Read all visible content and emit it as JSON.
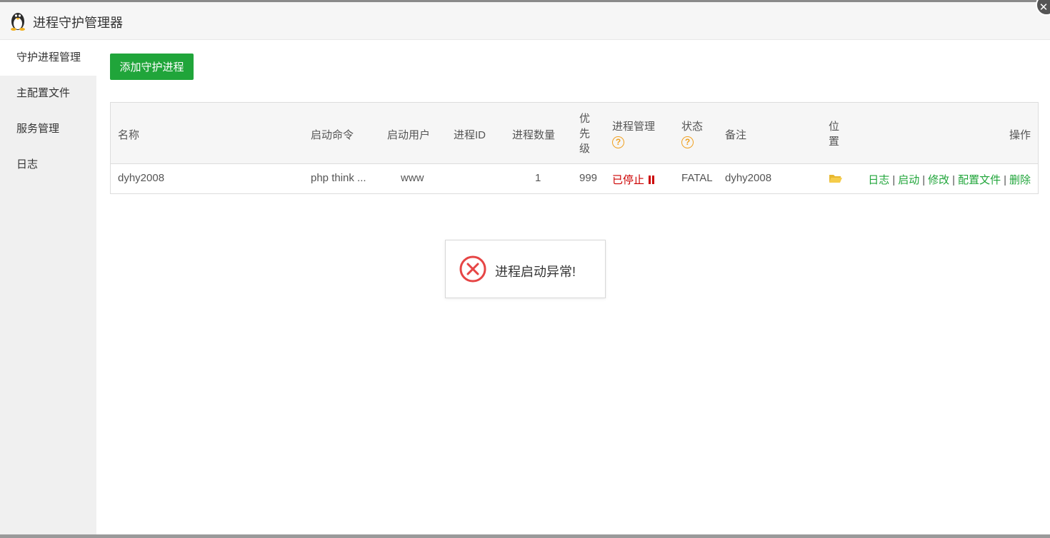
{
  "window": {
    "title": "进程守护管理器"
  },
  "sidebar": {
    "items": [
      {
        "label": "守护进程管理",
        "active": true
      },
      {
        "label": "主配置文件"
      },
      {
        "label": "服务管理"
      },
      {
        "label": "日志"
      }
    ]
  },
  "toolbar": {
    "add_label": "添加守护进程"
  },
  "table": {
    "headers": {
      "name": "名称",
      "command": "启动命令",
      "user": "启动用户",
      "pid": "进程ID",
      "count": "进程数量",
      "priority": [
        "优",
        "先",
        "级"
      ],
      "proc_manage": "进程管理",
      "status": "状态",
      "remark": "备注",
      "location": [
        "位",
        "置"
      ],
      "actions": "操作",
      "help": "?"
    },
    "rows": [
      {
        "name": "dyhy2008",
        "command": "php think ...",
        "user": "www",
        "pid": "",
        "count": "1",
        "priority": "999",
        "proc_state": "已停止",
        "status": "FATAL",
        "remark": "dyhy2008",
        "actions": [
          "日志",
          "启动",
          "修改",
          "配置文件",
          "删除"
        ],
        "action_sep": "|"
      }
    ]
  },
  "toast": {
    "message": "进程启动异常!"
  },
  "colors": {
    "accent": "#20a53a",
    "error": "#cc0000",
    "help": "#f0a020",
    "folder": "#f0c040"
  }
}
